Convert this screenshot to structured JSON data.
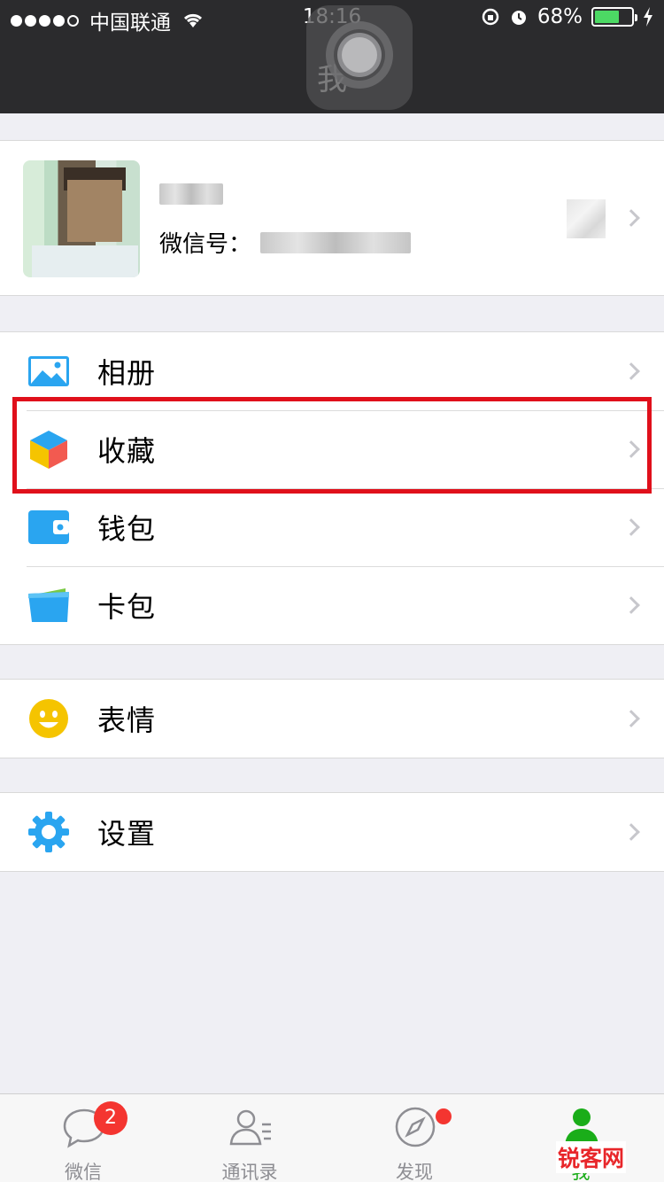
{
  "status_bar": {
    "carrier": "中国联通",
    "time": "18:16",
    "battery_text": "68%",
    "battery_level": 0.68,
    "signal_bars_filled": 4,
    "signal_bars_total": 5
  },
  "header": {
    "title": "我"
  },
  "profile": {
    "wechat_id_label": "微信号："
  },
  "menu_group_1": [
    {
      "label": "相册",
      "icon": "photo-album-icon"
    },
    {
      "label": "收藏",
      "icon": "favorites-cube-icon"
    },
    {
      "label": "钱包",
      "icon": "wallet-icon"
    },
    {
      "label": "卡包",
      "icon": "card-pack-icon"
    }
  ],
  "menu_group_2": [
    {
      "label": "表情",
      "icon": "sticker-smiley-icon"
    }
  ],
  "menu_group_3": [
    {
      "label": "设置",
      "icon": "settings-gear-icon"
    }
  ],
  "tabbar": {
    "tabs": [
      {
        "label": "微信",
        "icon": "chat-bubble-icon",
        "badge": "2"
      },
      {
        "label": "通讯录",
        "icon": "contacts-icon"
      },
      {
        "label": "发现",
        "icon": "compass-icon",
        "has_dot": true
      },
      {
        "label": "我",
        "icon": "me-person-icon",
        "active": true
      }
    ]
  },
  "watermark": {
    "text": "锐客网"
  },
  "colors": {
    "accent_green": "#1aad19",
    "badge_red": "#f43530",
    "highlight_red": "#e0101b",
    "header_bg": "#2b2b2d"
  }
}
